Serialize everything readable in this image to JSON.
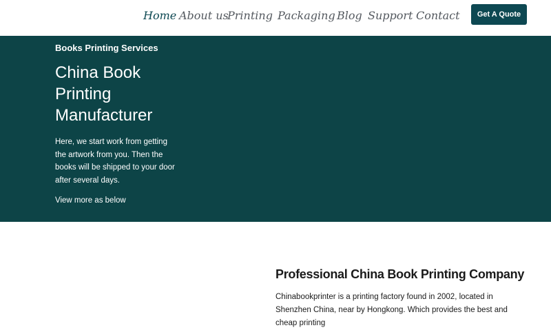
{
  "nav": {
    "items": [
      {
        "label": "Home",
        "active": true
      },
      {
        "label": "About us",
        "active": false
      },
      {
        "label": "Printing",
        "active": false
      },
      {
        "label": "Packaging",
        "active": false
      },
      {
        "label": "Blog",
        "active": false
      },
      {
        "label": "Support",
        "active": false
      },
      {
        "label": "Contact",
        "active": false
      }
    ],
    "cta_label": "Get A Quote"
  },
  "hero": {
    "eyebrow": "Books Printing Services",
    "title": "China Book Printing Manufacturer",
    "description": "Here, we start work from getting the artwork from you. Then the books will be shipped to your door after several days.",
    "link_label": "View more as below"
  },
  "section": {
    "title": "Professional China Book Printing Company",
    "body": "Chinabookprinter is a printing factory found in 2002, located in Shenzhen China, near by Hongkong. Which provides the best and cheap printing"
  },
  "colors": {
    "brand": "#0d4852",
    "hero_background": "#0d4447",
    "nav_text": "#54595f"
  }
}
